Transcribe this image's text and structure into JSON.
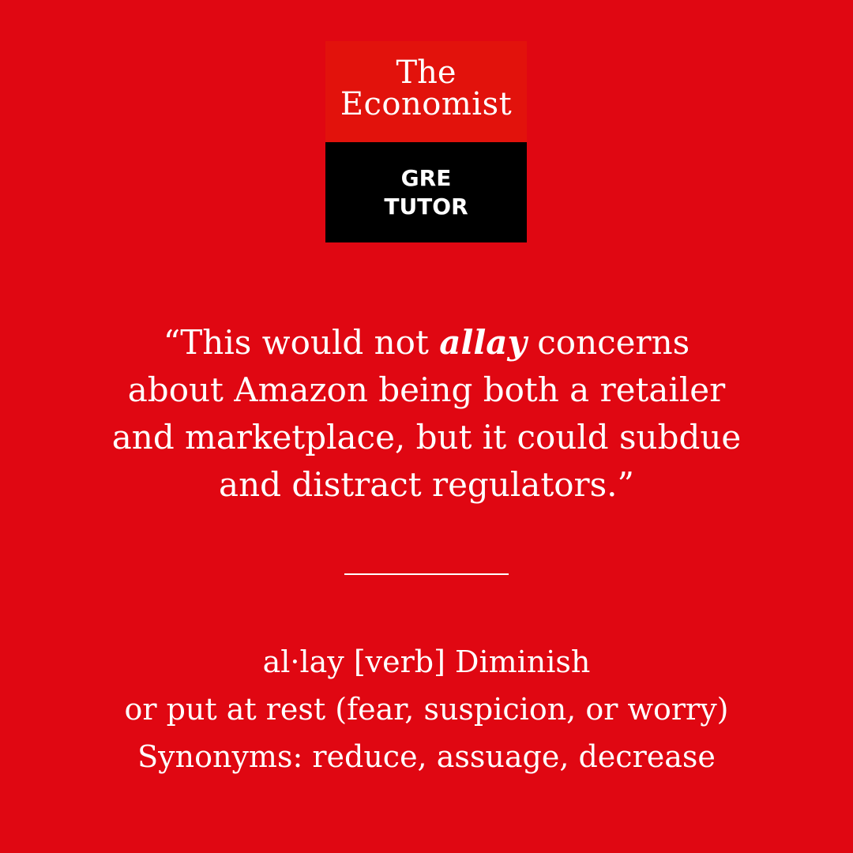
{
  "logo": {
    "title_line1": "The",
    "title_line2": "Economist",
    "sub_line1": "GRE",
    "sub_line2": "TUTOR"
  },
  "quote": {
    "open": "“This would not ",
    "highlight": "allay",
    "after_highlight": " concerns",
    "line2": "about Amazon being both a retailer",
    "line3": "and marketplace, but it could subdue",
    "line4": "and distract regulators.”"
  },
  "definition": {
    "line1": "al·lay [verb] Diminish",
    "line2": "or put at rest (fear, suspicion, or worry)",
    "line3": "Synonyms: reduce, assuage, decrease"
  },
  "colors": {
    "background": "#e00712",
    "logo_red": "#e2120c",
    "logo_black": "#000000",
    "text": "#ffffff"
  }
}
